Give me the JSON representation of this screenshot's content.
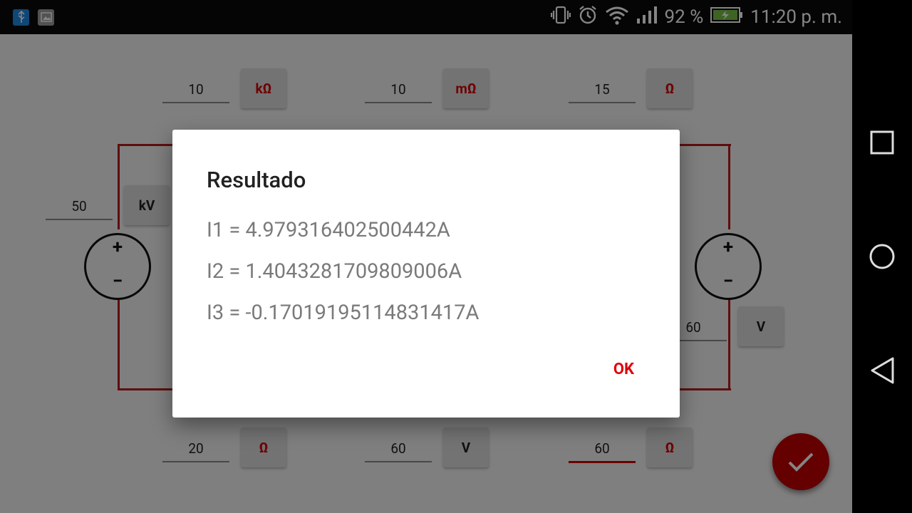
{
  "status_bar": {
    "battery_percent": "92 %",
    "time": "11:20 p. m.",
    "left_icons": [
      "usb-icon",
      "image-icon"
    ],
    "right_icons": [
      "vibrate-icon",
      "alarm-icon",
      "wifi-icon",
      "signal-icon",
      "battery-icon"
    ]
  },
  "circuit": {
    "top_fields": [
      {
        "value": "10",
        "unit": "kΩ"
      },
      {
        "value": "10",
        "unit": "mΩ"
      },
      {
        "value": "15",
        "unit": "Ω"
      }
    ],
    "left_source": {
      "value": "50",
      "unit": "kV",
      "plus": "+",
      "minus": "−"
    },
    "right_source": {
      "value": "60",
      "unit": "V",
      "plus": "+",
      "minus": "−"
    },
    "bottom_fields": [
      {
        "value": "20",
        "unit": "Ω"
      },
      {
        "value": "60",
        "unit": "V"
      },
      {
        "value": "60",
        "unit": "Ω"
      }
    ]
  },
  "dialog": {
    "title": "Resultado",
    "lines": [
      "I1 = 4.979316402500442A",
      "I2 = 1.4043281709809006A",
      "I3 = -0.17019195114831417A"
    ],
    "ok_label": "OK"
  },
  "colors": {
    "accent": "#d50000",
    "wire": "#b71c1c"
  }
}
